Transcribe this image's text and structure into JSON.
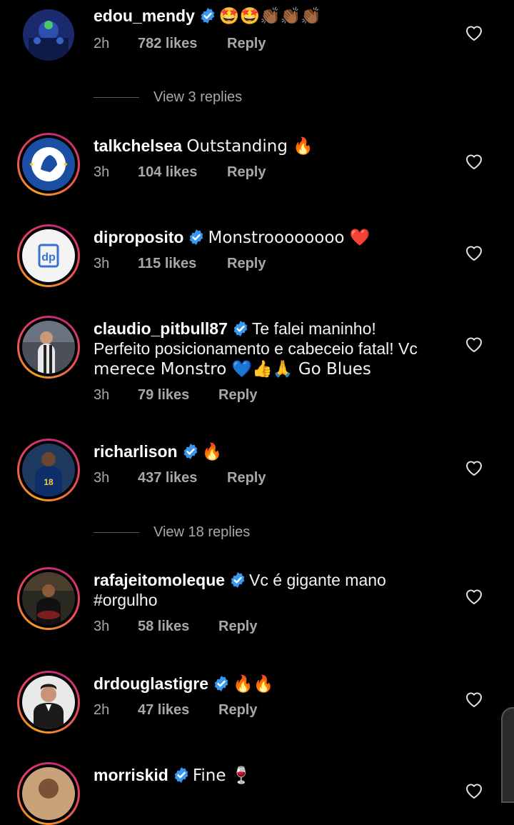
{
  "comments": [
    {
      "username": "edou_mendy",
      "verified": true,
      "text": "🤩🤩👏🏾👏🏾👏🏾",
      "time": "2h",
      "likes": "782 likes",
      "reply": "Reply",
      "ring": false
    },
    {
      "username": "talkchelsea",
      "verified": false,
      "text": "Outstanding 🔥",
      "time": "3h",
      "likes": "104 likes",
      "reply": "Reply",
      "ring": true
    },
    {
      "username": "diproposito",
      "verified": true,
      "text": "Monstroooooooo ❤️",
      "time": "3h",
      "likes": "115 likes",
      "reply": "Reply",
      "ring": true
    },
    {
      "username": "claudio_pitbull87",
      "verified": true,
      "text": "Te falei maninho!",
      "text2": "Perfeito posicionamento e cabeceio fatal! Vc",
      "text3": "merece Monstro 💙👍🙏 Go Blues",
      "time": "3h",
      "likes": "79 likes",
      "reply": "Reply",
      "ring": true
    },
    {
      "username": "richarlison",
      "verified": true,
      "text": "🔥",
      "time": "3h",
      "likes": "437 likes",
      "reply": "Reply",
      "ring": true
    },
    {
      "username": "rafajeitomoleque",
      "verified": true,
      "text": "Vc é gigante mano",
      "text2": "#orgulho",
      "time": "3h",
      "likes": "58 likes",
      "reply": "Reply",
      "ring": true
    },
    {
      "username": "drdouglastigre",
      "verified": true,
      "text": "🔥🔥",
      "time": "2h",
      "likes": "47 likes",
      "reply": "Reply",
      "ring": true
    },
    {
      "username": "morriskid",
      "verified": true,
      "text": "Fine 🍷",
      "ring": true
    }
  ],
  "view_replies": [
    "View 3 replies",
    "View 18 replies"
  ],
  "icons": {
    "heart": "heart-outline-icon",
    "verified": "verified-badge-icon"
  },
  "colors": {
    "verified": "#3897f0",
    "muted": "#a8a8a8",
    "background": "#000000"
  }
}
